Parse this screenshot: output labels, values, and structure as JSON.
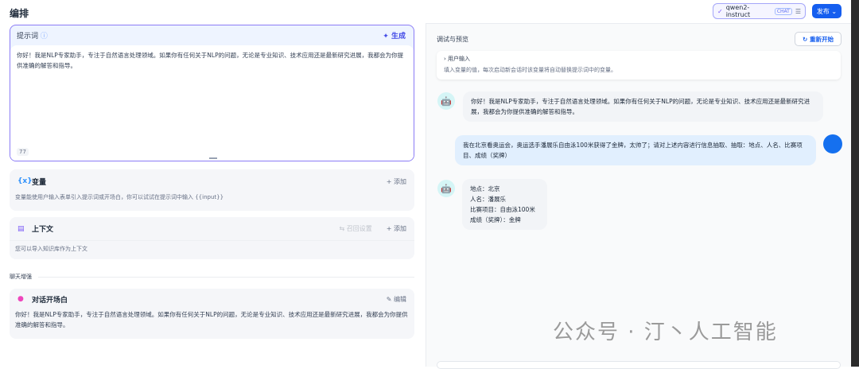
{
  "header": {
    "title": "编排",
    "model": "qwen2-instruct",
    "model_badge": "CHAT",
    "publish": "发布"
  },
  "prompt": {
    "label": "提示词",
    "generate": "生成",
    "text": "你好！我是NLP专家助手，专注于自然语言处理领域。如果你有任何关于NLP的问题，无论是专业知识、技术应用还是最新研究进展，我都会为你提供准确的解答和指导。",
    "count": "77"
  },
  "variables": {
    "label": "变量",
    "add": "添加",
    "desc": "变量能使用户输入表单引入提示词或开场白，你可以试试在提示词中输入 {{input}}"
  },
  "context": {
    "label": "上下文",
    "recall": "召回设置",
    "add": "添加",
    "desc": "您可以导入知识库作为上下文"
  },
  "section": "聊天增强",
  "opener": {
    "label": "对话开场白",
    "edit": "编辑",
    "text": "你好！我是NLP专家助手，专注于自然语言处理领域。如果你有任何关于NLP的问题，无论是专业知识、技术应用还是最新研究进展，我都会为你提供准确的解答和指导。"
  },
  "debug": {
    "title": "调试与预览",
    "restart": "重新开始",
    "user_input_label": "用户输入",
    "user_input_desc": "填入变量的值，每次启动新会话时该变量将自动替换提示词中的变量。"
  },
  "messages": [
    {
      "role": "bot",
      "text": "你好！我是NLP专家助手，专注于自然语言处理领域。如果你有任何关于NLP的问题，无论是专业知识、技术应用还是最新研究进展，我都会为你提供准确的解答和指导。"
    },
    {
      "role": "user",
      "text": "我在北京看奥运会，奥运选手潘展乐自由泳100米获得了金牌，太帅了；请对上述内容进行信息抽取、抽取：地点、人名、比赛项目、成绩（奖牌）"
    },
    {
      "role": "bot",
      "lines": [
        "地点：北京",
        "人名：潘展乐",
        "比赛项目：自由泳100米",
        "成绩（奖牌）：金牌"
      ]
    }
  ],
  "watermark": "公众号 · 汀丶人工智能"
}
